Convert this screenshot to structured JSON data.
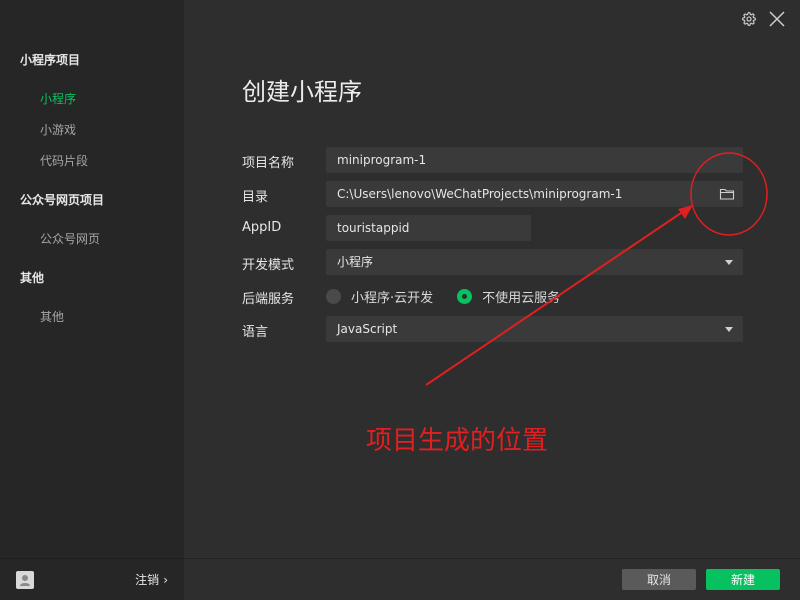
{
  "sidebar": {
    "groups": [
      {
        "label": "小程序项目",
        "items": [
          {
            "label": "小程序",
            "active": true
          },
          {
            "label": "小游戏",
            "active": false
          },
          {
            "label": "代码片段",
            "active": false
          }
        ]
      },
      {
        "label": "公众号网页项目",
        "items": [
          {
            "label": "公众号网页",
            "active": false
          }
        ]
      },
      {
        "label": "其他",
        "items": [
          {
            "label": "其他",
            "active": false
          }
        ]
      }
    ],
    "footer": {
      "logout_label": "注销",
      "logout_chevron": "›"
    }
  },
  "header": {
    "icons": [
      "gear-icon",
      "close-icon"
    ]
  },
  "main": {
    "title": "创建小程序",
    "form": {
      "project_name": {
        "label": "项目名称",
        "value": "miniprogram-1"
      },
      "directory": {
        "label": "目录",
        "value": "C:\\Users\\lenovo\\WeChatProjects\\miniprogram-1"
      },
      "appid": {
        "label": "AppID",
        "value": "touristappid"
      },
      "dev_mode": {
        "label": "开发模式",
        "value": "小程序"
      },
      "backend": {
        "label": "后端服务",
        "options": [
          {
            "label": "小程序·云开发",
            "checked": false
          },
          {
            "label": "不使用云服务",
            "checked": true
          }
        ]
      },
      "language": {
        "label": "语言",
        "value": "JavaScript"
      }
    },
    "annotation": {
      "text": "项目生成的位置",
      "color": "#e02020"
    },
    "footer": {
      "cancel_label": "取消",
      "create_label": "新建"
    }
  },
  "colors": {
    "accent": "#07c160",
    "background": "#2e2e2e",
    "sidebar": "#262626",
    "field": "#3a3a3a"
  }
}
